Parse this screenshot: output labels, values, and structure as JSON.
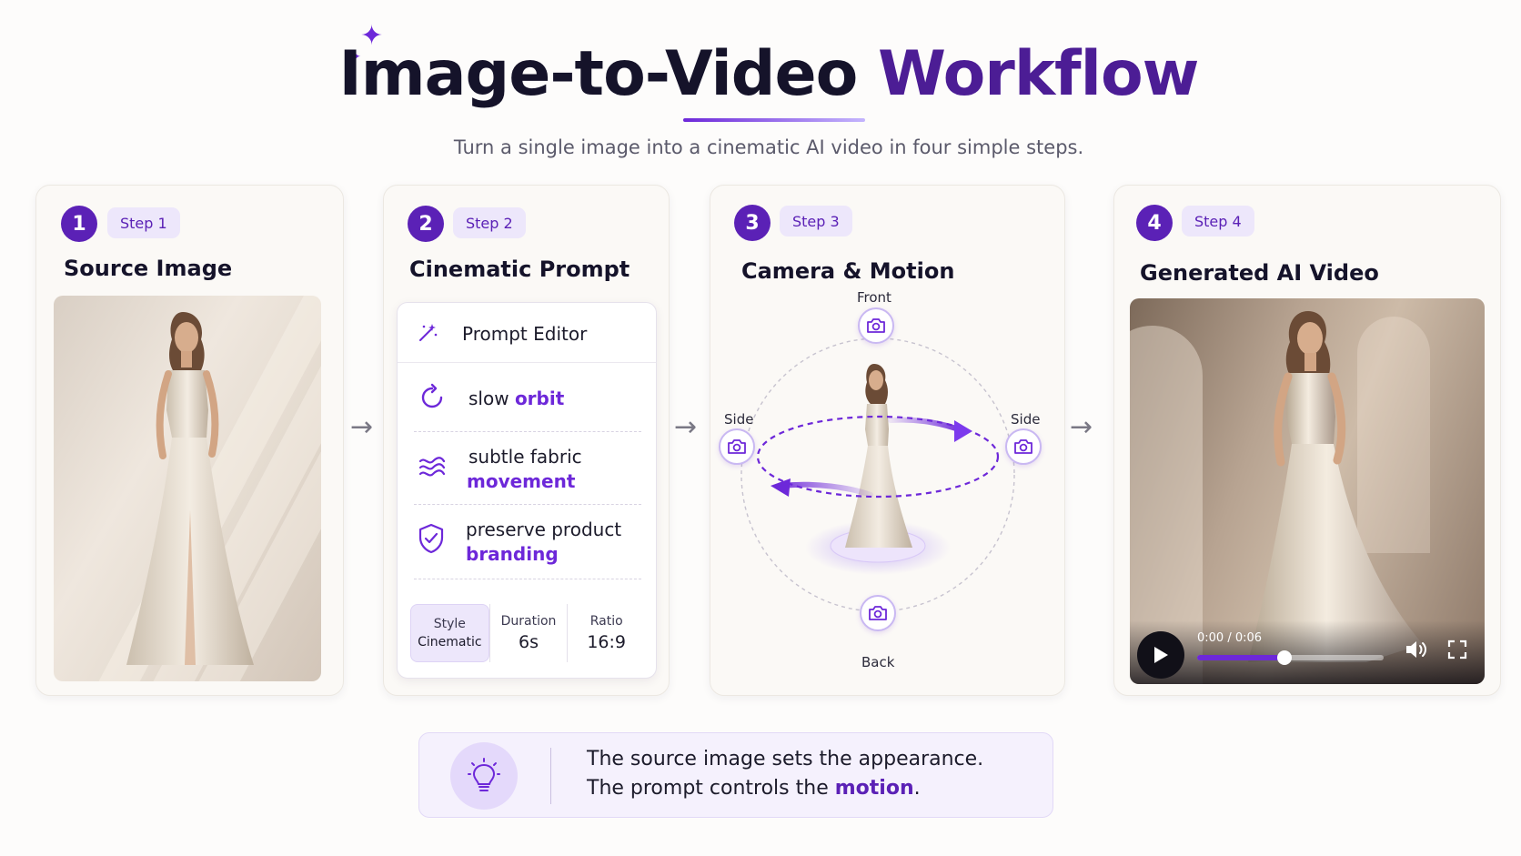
{
  "header": {
    "title_main": "Image-to-Video",
    "title_accent": "Workflow",
    "subtitle": "Turn a single image into a cinematic AI video in four simple steps."
  },
  "colors": {
    "accent": "#6d28d9",
    "accent_dark": "#4c1d95",
    "pill_bg": "#ede7fb",
    "text": "#15132a"
  },
  "steps": [
    {
      "number": "1",
      "pill": "Step 1",
      "title": "Source Image"
    },
    {
      "number": "2",
      "pill": "Step 2",
      "title": "Cinematic Prompt"
    },
    {
      "number": "3",
      "pill": "Step 3",
      "title": "Camera & Motion"
    },
    {
      "number": "4",
      "pill": "Step 4",
      "title": "Generated AI Video"
    }
  ],
  "prompt_editor": {
    "header_label": "Prompt Editor",
    "header_icon": "magic-wand-icon",
    "rows": [
      {
        "icon": "orbit-icon",
        "text": "slow",
        "keyword": "orbit"
      },
      {
        "icon": "waves-icon",
        "text": "subtle fabric",
        "keyword": "movement"
      },
      {
        "icon": "shield-check-icon",
        "text": "preserve product",
        "keyword": "branding"
      }
    ],
    "params": [
      {
        "key": "Style",
        "value": "Cinematic"
      },
      {
        "key": "Duration",
        "value": "6s"
      },
      {
        "key": "Ratio",
        "value": "16:9"
      }
    ]
  },
  "camera": {
    "front": "Front",
    "side_left": "Side",
    "side_right": "Side",
    "back": "Back",
    "icon": "camera-icon"
  },
  "video": {
    "time": "0:00 / 0:06",
    "progress": 0.47,
    "play_icon": "play-icon",
    "volume_icon": "volume-icon",
    "fullscreen_icon": "fullscreen-icon"
  },
  "callout": {
    "icon": "lightbulb-icon",
    "line1": "The source image sets the appearance.",
    "line2_text": "The prompt controls the",
    "line2_keyword": "motion",
    "line2_end": "."
  }
}
